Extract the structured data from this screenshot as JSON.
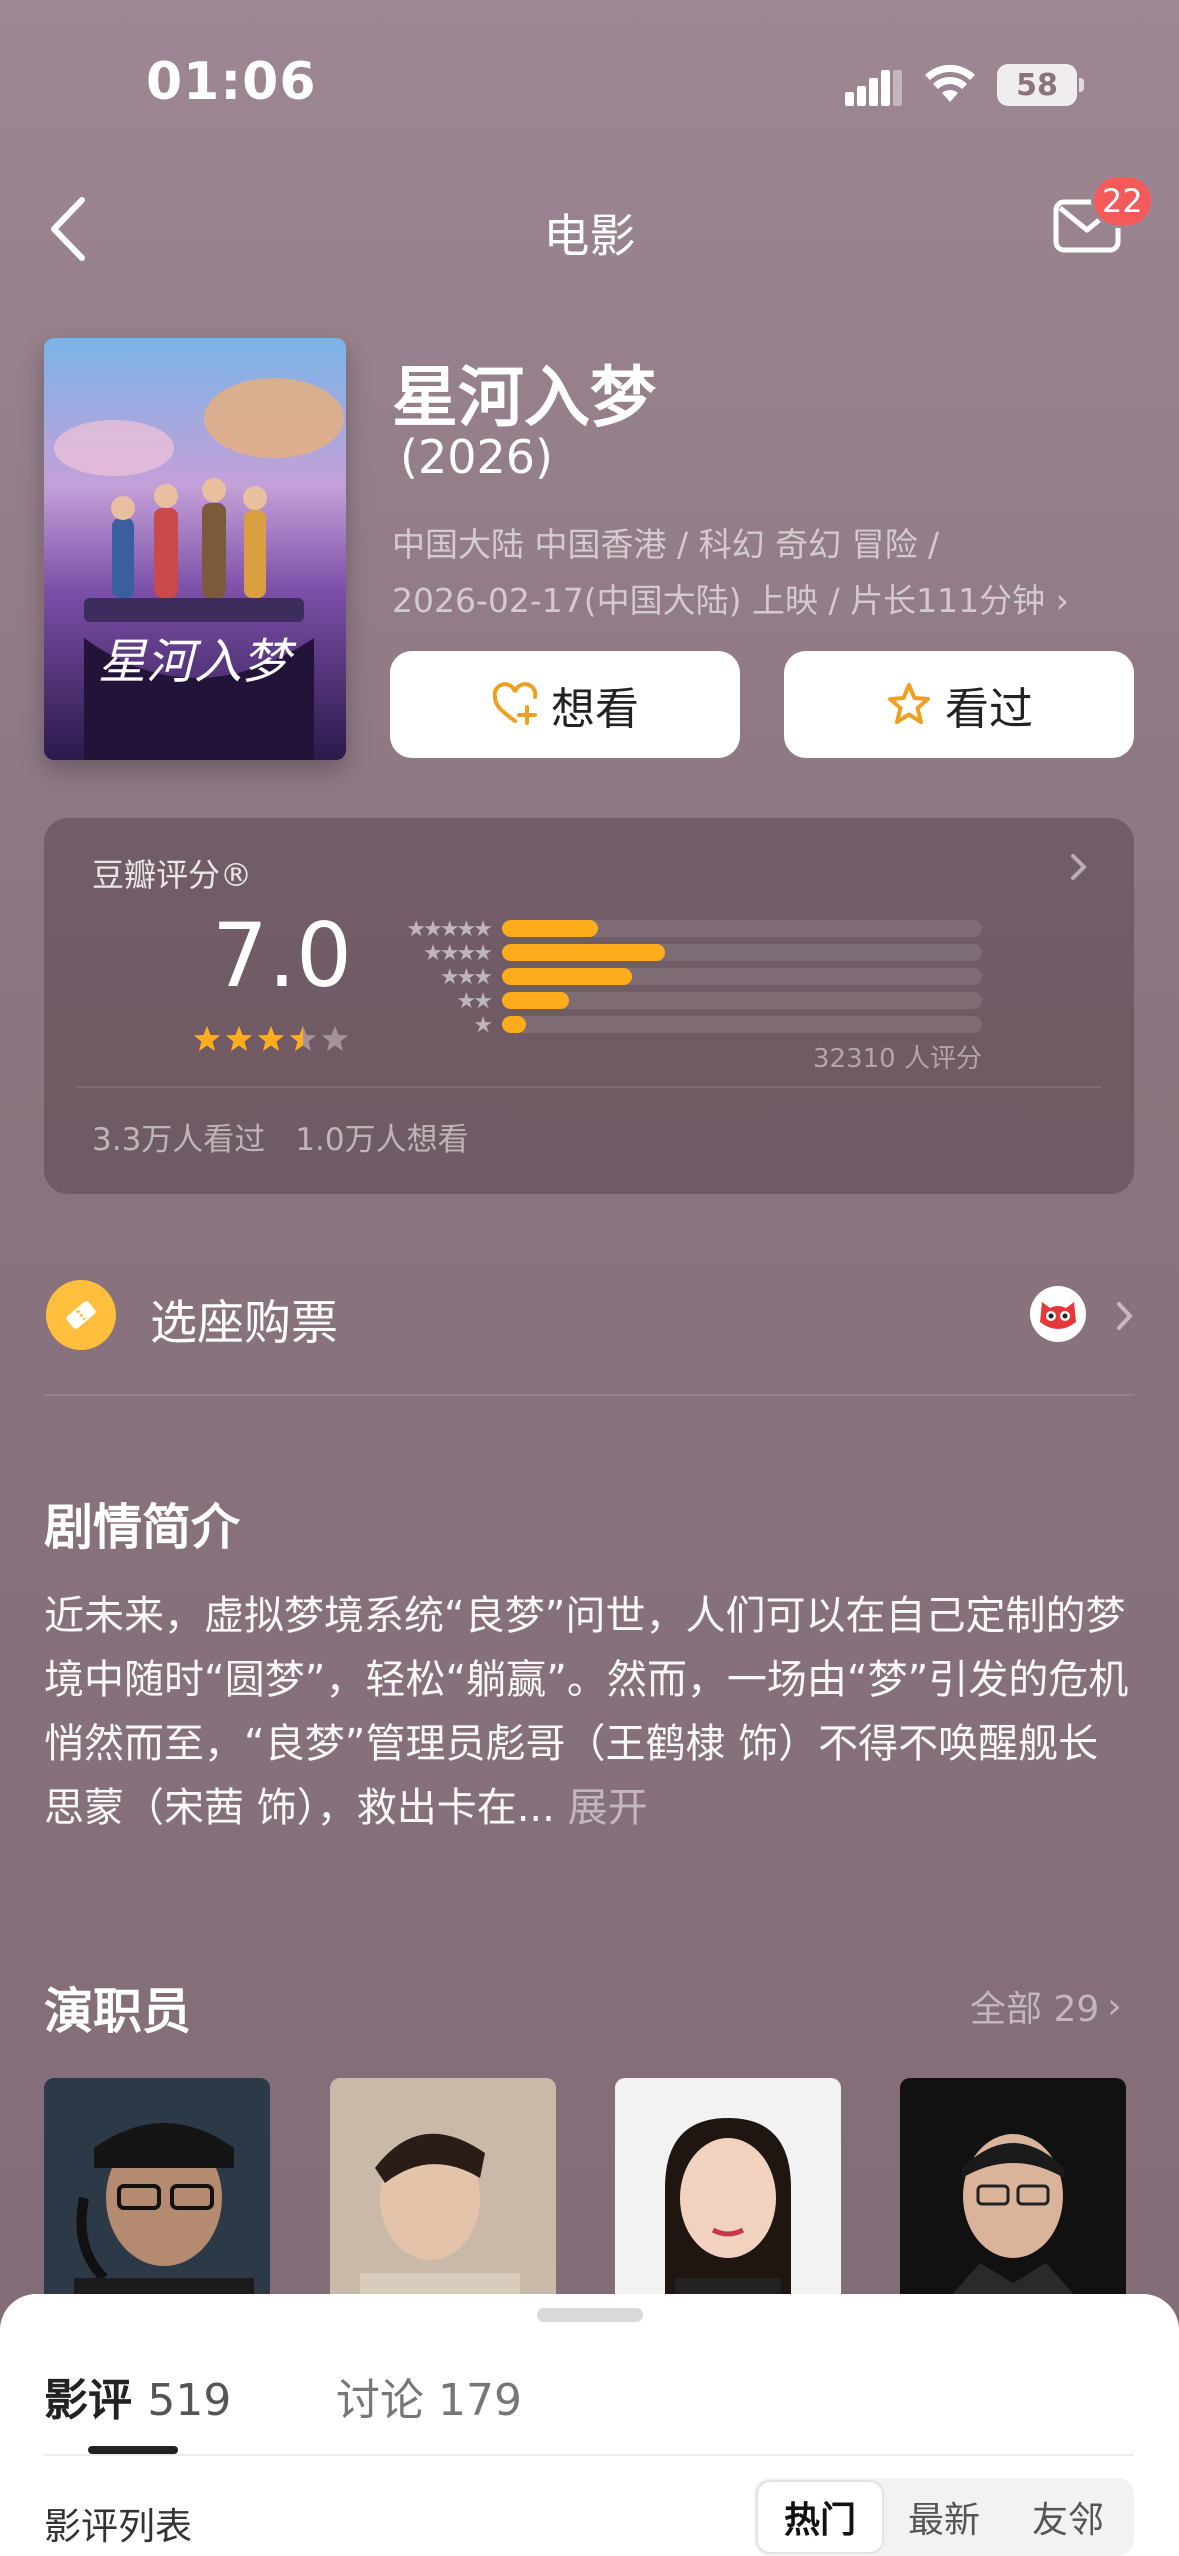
{
  "status": {
    "time": "01:06",
    "battery": "58"
  },
  "nav": {
    "title": "电影",
    "mail_badge": "22"
  },
  "movie": {
    "title": "星河入梦",
    "year": "(2026)",
    "meta_line1": "中国大陆 中国香港 / 科幻 奇幻 冒险 /",
    "meta_line2": "2026-02-17(中国大陆) 上映 / 片长111分钟",
    "want_label": "想看",
    "seen_label": "看过"
  },
  "rating": {
    "label": "豆瓣评分®",
    "score": "7.0",
    "stars_value": 3.5,
    "count": "32310 人评分",
    "distribution": [
      0.2,
      0.34,
      0.27,
      0.14,
      0.05
    ],
    "seen": "3.3万人看过",
    "want": "1.0万人想看"
  },
  "tickets": {
    "label": "选座购票"
  },
  "synopsis": {
    "title": "剧情简介",
    "text": "近未来，虚拟梦境系统“良梦”问世，人们可以在自己定制的梦境中随时“圆梦”，轻松“躺赢”。然而，一场由“梦”引发的危机悄然而至，“良梦”管理员彪哥（王鹤棣 饰）不得不唤醒舰长思蒙（宋茜 饰），救出卡在...",
    "more": "展开"
  },
  "cast": {
    "title": "演职员",
    "all_label": "全部 29"
  },
  "sheet": {
    "tab_reviews": "影评",
    "tab_reviews_count": "519",
    "tab_discussion": "讨论 179",
    "list_label": "影评列表",
    "segments": [
      "热门",
      "最新",
      "友邻"
    ]
  },
  "colors": {
    "accent": "#ffac1c",
    "badge": "#f45a5a"
  }
}
